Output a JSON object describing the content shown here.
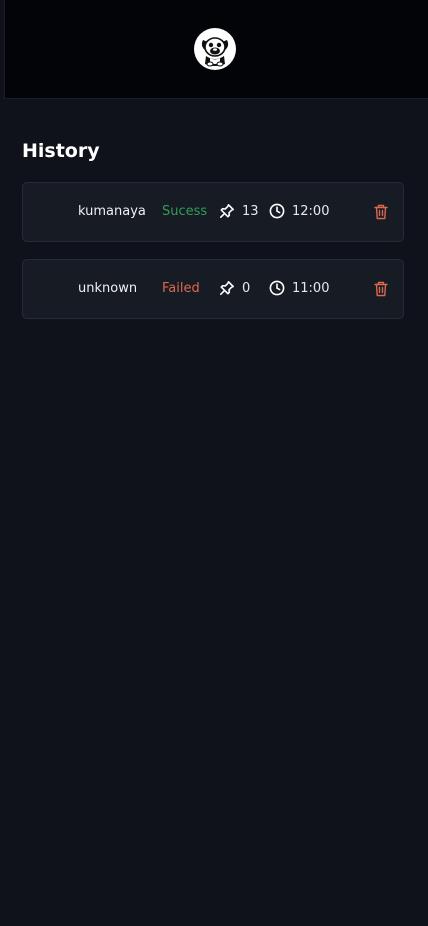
{
  "header": {
    "logo_icon": "pug-dog-logo-icon"
  },
  "history": {
    "title": "History",
    "items": [
      {
        "name": "kumanaya",
        "status": "Sucess",
        "status_color": "#2f9e57",
        "pins": "13",
        "time": "12:00"
      },
      {
        "name": "unknown",
        "status": "Failed",
        "status_color": "#d9694e",
        "pins": "0",
        "time": "11:00"
      }
    ]
  },
  "colors": {
    "background": "#0f121a",
    "header_background": "#020408",
    "card_background": "#171b23",
    "delete_icon": "#d9694e"
  }
}
